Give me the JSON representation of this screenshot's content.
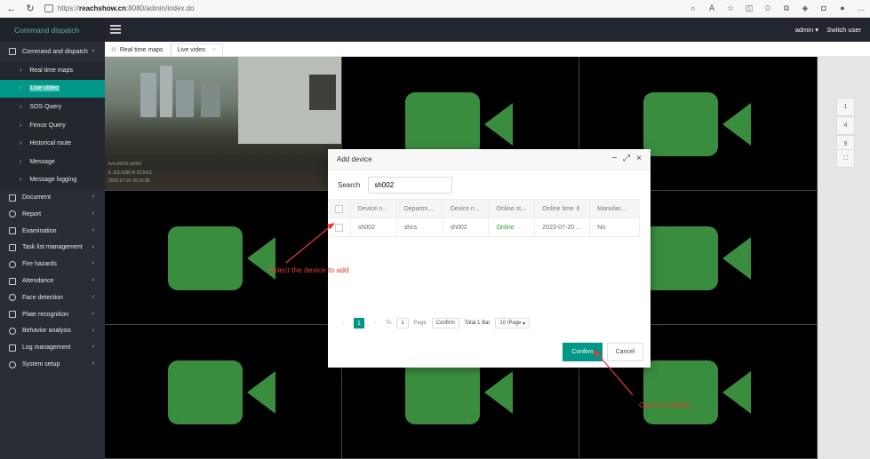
{
  "browser": {
    "url_prefix": "https://",
    "url_host": "reachshow.cn",
    "url_path": ":8080/admin/index.do"
  },
  "header": {
    "logo": "Command dispatch",
    "user": "admin",
    "switch_user": "Switch user"
  },
  "sidebar": {
    "items": [
      {
        "label": "Command and dispatch",
        "icon": "monitor-icon"
      },
      {
        "label": "Document",
        "icon": "folder-icon"
      },
      {
        "label": "Report",
        "icon": "report-icon"
      },
      {
        "label": "Examination",
        "icon": "exam-icon"
      },
      {
        "label": "Task list management",
        "icon": "task-icon"
      },
      {
        "label": "Fire hazards",
        "icon": "fire-icon"
      },
      {
        "label": "Attendance",
        "icon": "calendar-icon"
      },
      {
        "label": "Face detection",
        "icon": "face-icon"
      },
      {
        "label": "Plate recognition",
        "icon": "plate-icon"
      },
      {
        "label": "Behavior analysis",
        "icon": "behavior-icon"
      },
      {
        "label": "Log management",
        "icon": "log-icon"
      },
      {
        "label": "System setup",
        "icon": "settings-icon"
      }
    ],
    "subitems": [
      {
        "label": "Real time maps"
      },
      {
        "label": "Live video"
      },
      {
        "label": "SOS Query"
      },
      {
        "label": "Fence Query"
      },
      {
        "label": "Historical route"
      },
      {
        "label": "Message"
      },
      {
        "label": "Message logging"
      }
    ]
  },
  "tabs": [
    {
      "label": "Real time maps"
    },
    {
      "label": "Live video"
    }
  ],
  "live_feed": {
    "name": "live:sh002:sh002",
    "coords": "E 113.9290 N 22.5411",
    "time": "2023-07-20 16:10:30"
  },
  "layout_buttons": [
    "1",
    "4",
    "9",
    "⛶"
  ],
  "dialog": {
    "title": "Add device",
    "search_label": "Search",
    "search_value": "sh002",
    "columns": [
      "Device n...",
      "Departm...",
      "Device n...",
      "Online st...",
      "Online time ⇕",
      "Manufac..."
    ],
    "rows": [
      [
        "sh002",
        "shcs",
        "sh002",
        "Online",
        "2023-07-20 ...",
        "No"
      ]
    ],
    "pager": {
      "current": "1",
      "to_label": "To",
      "to_value": "1",
      "page_label": "Page",
      "confirm": "Confirm",
      "total": "Total 1 Bar",
      "per_page": "10 /Page"
    },
    "confirm": "Confirm",
    "cancel": "Cancel"
  },
  "annotations": {
    "select": "Select the device to add",
    "confirm": "Click to confirm"
  }
}
